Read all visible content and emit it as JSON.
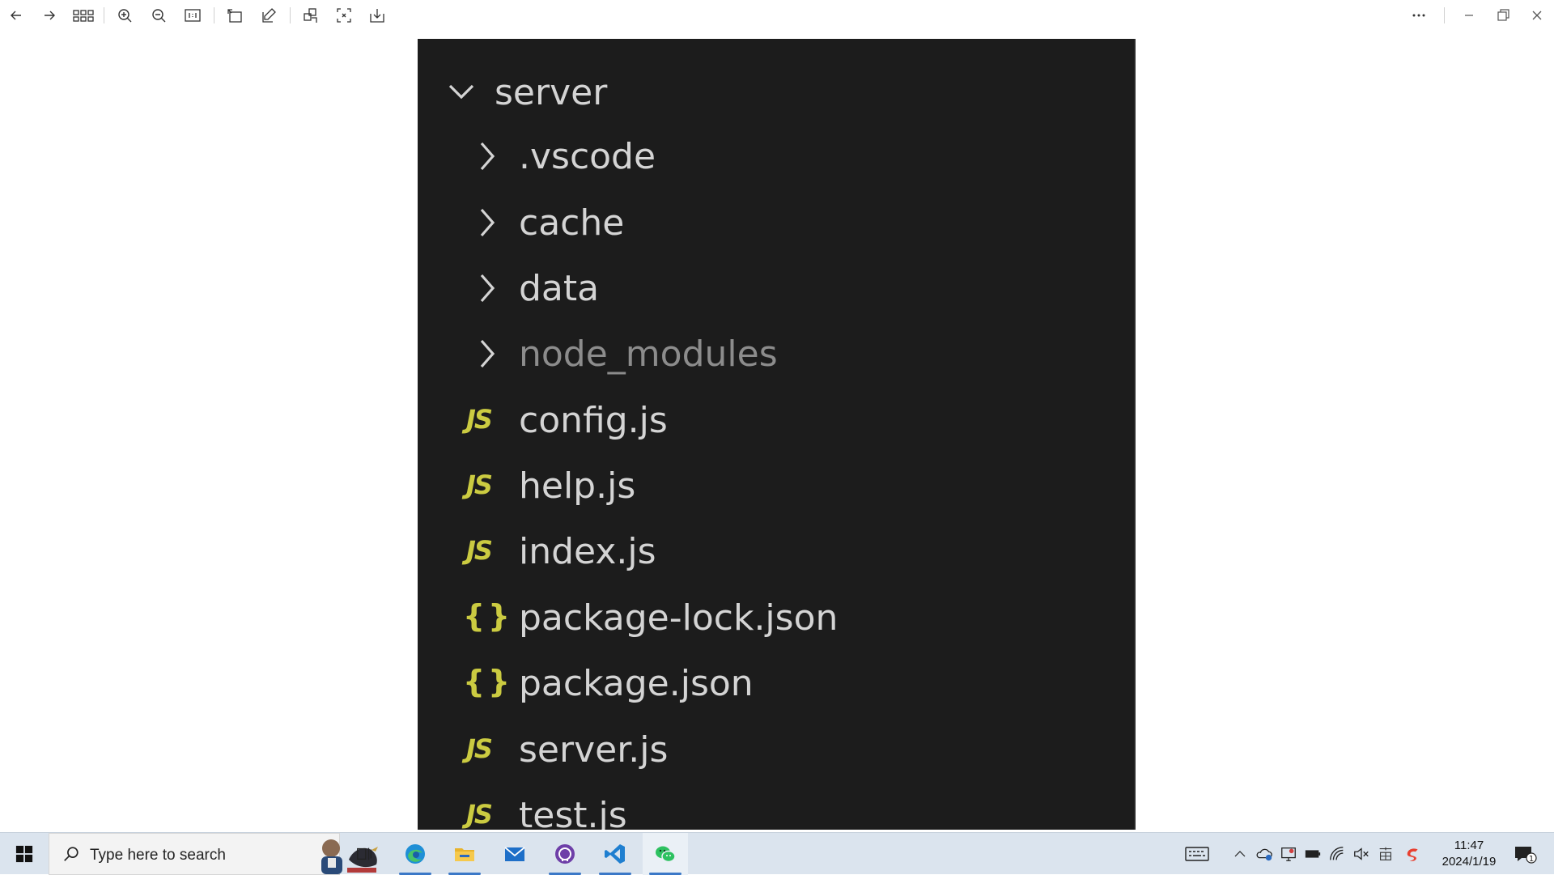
{
  "toolbar": {
    "buttons": [
      {
        "name": "back-arrow-icon"
      },
      {
        "name": "forward-arrow-icon"
      },
      {
        "name": "grid-view-icon"
      },
      {
        "name": "zoom-in-icon"
      },
      {
        "name": "zoom-out-icon"
      },
      {
        "name": "actual-size-icon"
      },
      {
        "name": "rotate-icon"
      },
      {
        "name": "edit-icon"
      },
      {
        "name": "crop-icon"
      },
      {
        "name": "fullscreen-icon"
      },
      {
        "name": "save-icon"
      },
      {
        "name": "more-icon"
      },
      {
        "name": "minimize-icon"
      },
      {
        "name": "restore-icon"
      },
      {
        "name": "close-icon"
      }
    ]
  },
  "explorer": {
    "root": {
      "label": "server",
      "expanded": true
    },
    "items": [
      {
        "label": ".vscode",
        "kind": "folder",
        "dim": false
      },
      {
        "label": "cache",
        "kind": "folder",
        "dim": false
      },
      {
        "label": "data",
        "kind": "folder",
        "dim": false
      },
      {
        "label": "node_modules",
        "kind": "folder",
        "dim": true
      },
      {
        "label": "config.js",
        "kind": "js",
        "icon_text": "JS"
      },
      {
        "label": "help.js",
        "kind": "js",
        "icon_text": "JS"
      },
      {
        "label": "index.js",
        "kind": "js",
        "icon_text": "JS"
      },
      {
        "label": "package-lock.json",
        "kind": "json",
        "icon_text": "{}"
      },
      {
        "label": "package.json",
        "kind": "json",
        "icon_text": "{}"
      },
      {
        "label": "server.js",
        "kind": "js",
        "icon_text": "JS"
      },
      {
        "label": "test.js",
        "kind": "js",
        "icon_text": "JS"
      }
    ],
    "colors": {
      "background": "#1c1c1c",
      "text": "#d4d4d4",
      "dim_text": "#8c8c8c",
      "icon_yellow": "#cbcb41"
    }
  },
  "taskbar": {
    "search_placeholder": "Type here to search",
    "apps": [
      {
        "name": "task-view-icon"
      },
      {
        "name": "edge-icon"
      },
      {
        "name": "file-explorer-icon"
      },
      {
        "name": "mail-icon"
      },
      {
        "name": "github-desktop-icon"
      },
      {
        "name": "vscode-icon"
      },
      {
        "name": "wechat-icon"
      }
    ],
    "tray": [
      {
        "name": "keyboard-icon"
      },
      {
        "name": "show-hidden-icons-chevron"
      },
      {
        "name": "onedrive-icon"
      },
      {
        "name": "monitor-icon"
      },
      {
        "name": "battery-icon"
      },
      {
        "name": "wifi-icon"
      },
      {
        "name": "volume-muted-icon"
      },
      {
        "name": "ime-icon"
      },
      {
        "name": "sogou-icon"
      },
      {
        "name": "notification-icon"
      }
    ],
    "clock": {
      "time": "11:47",
      "date": "2024/1/19"
    },
    "notification_count": "1"
  }
}
